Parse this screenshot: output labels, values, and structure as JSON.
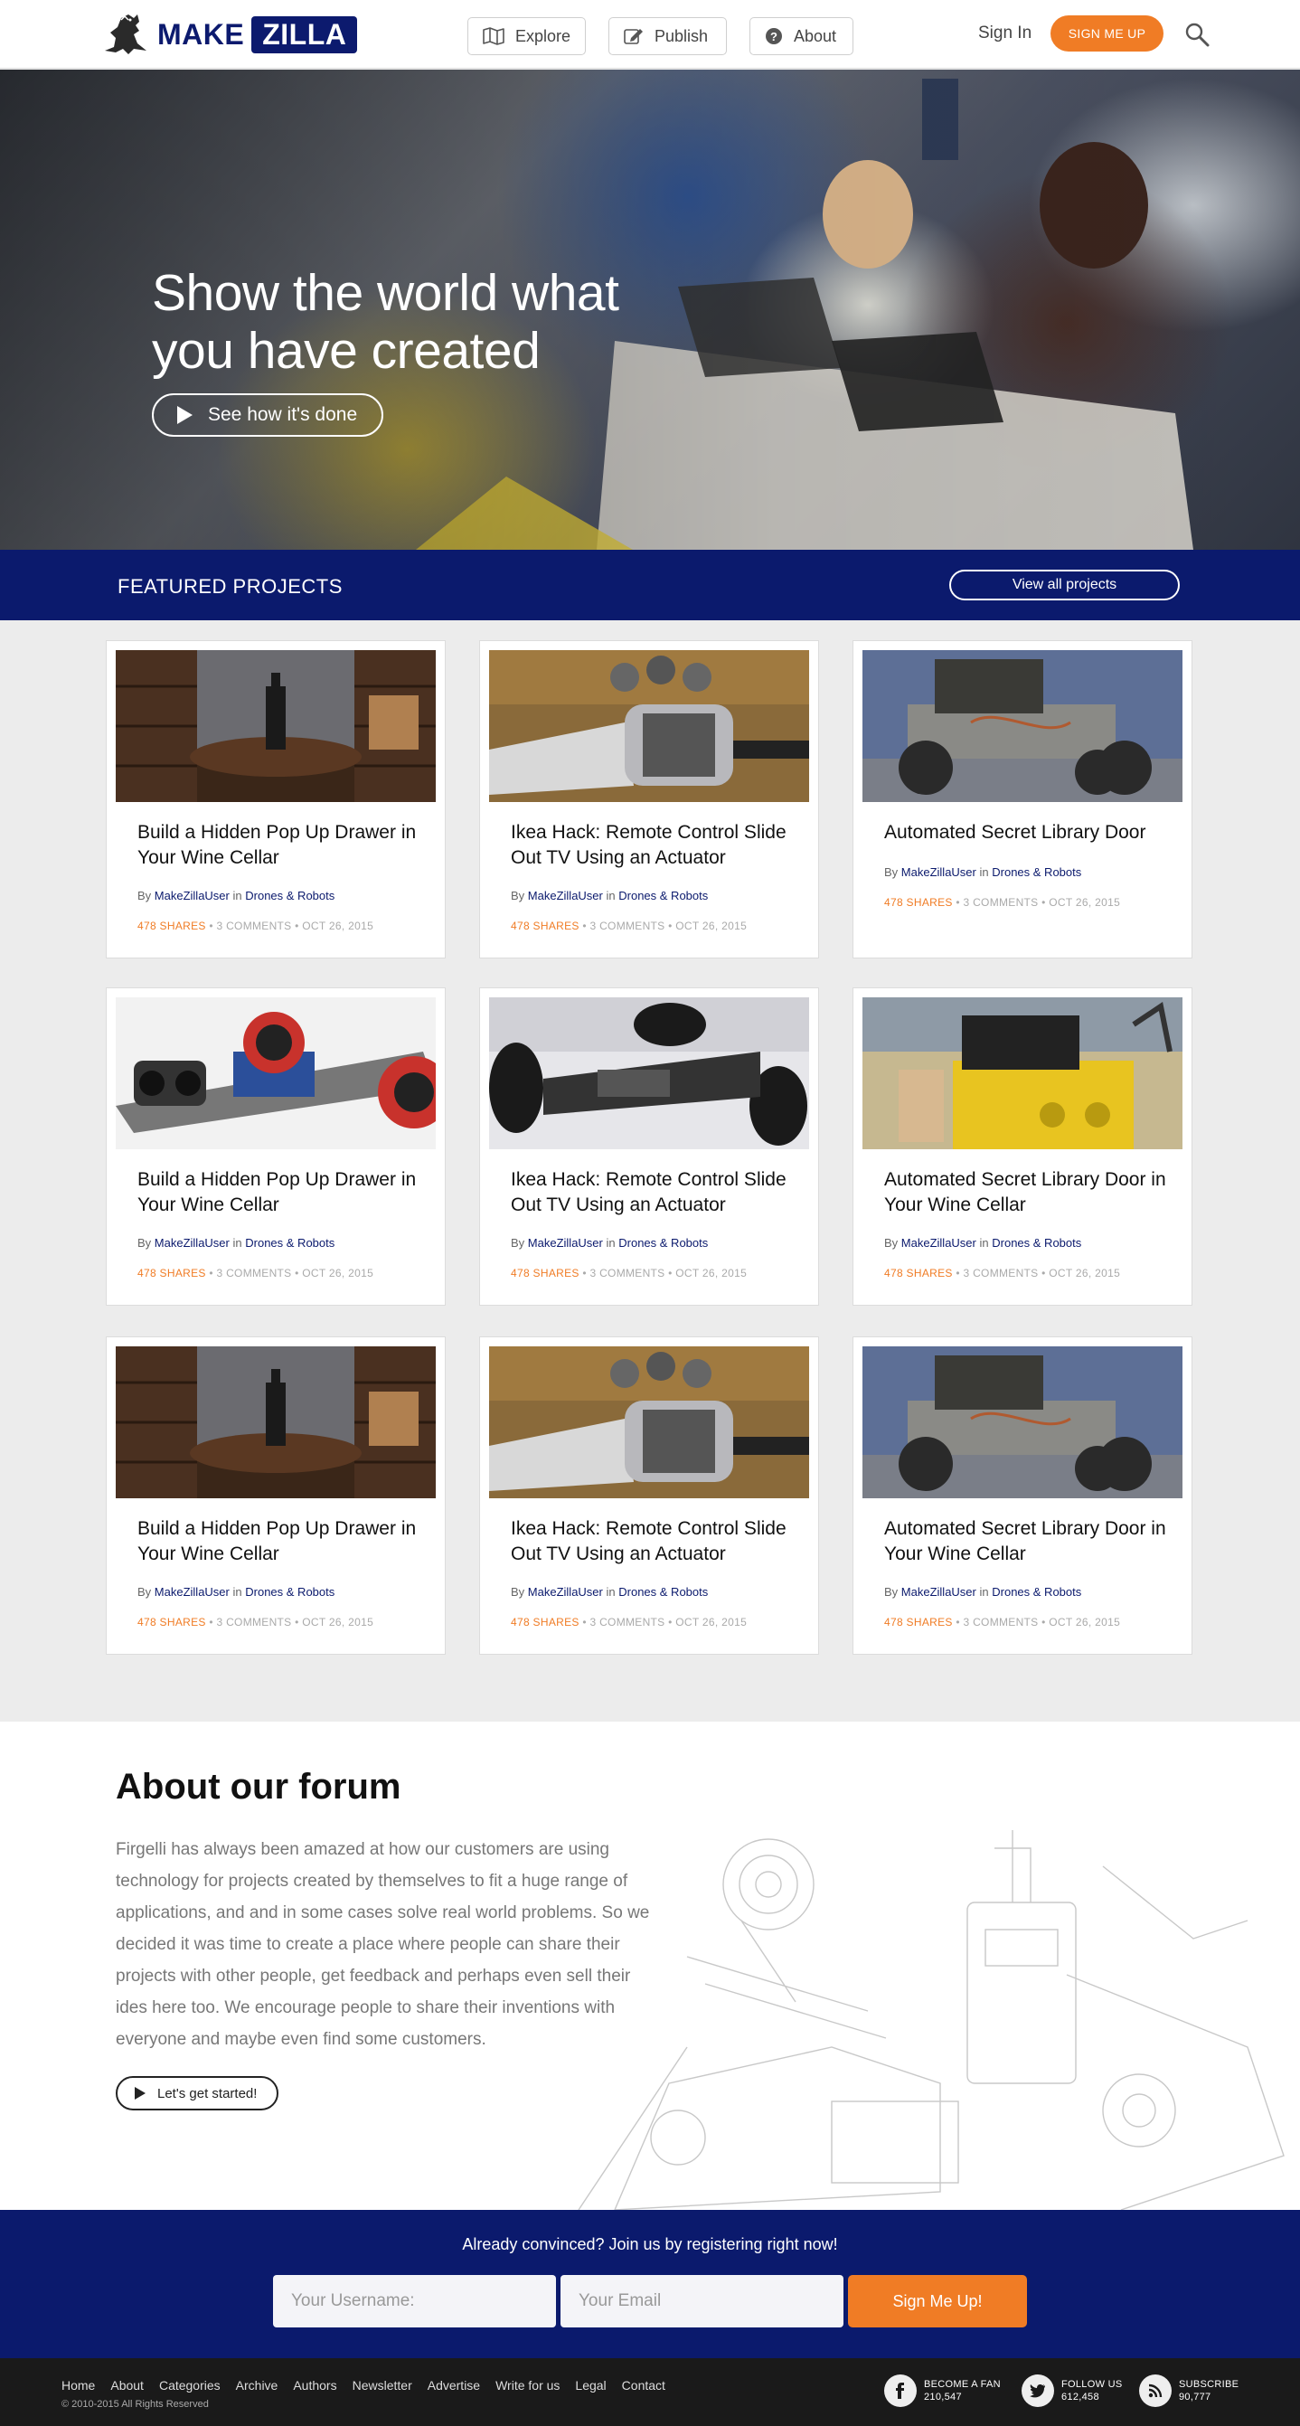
{
  "header": {
    "logo_make": "MAKE",
    "logo_zilla": "ZILLA",
    "nav": [
      {
        "label": "Explore",
        "icon": "map-icon"
      },
      {
        "label": "Publish",
        "icon": "edit-icon"
      },
      {
        "label": "About",
        "icon": "help-icon"
      }
    ],
    "signin": "Sign In",
    "signup": "SIGN ME UP"
  },
  "hero": {
    "title": "Show the world what you have created",
    "cta": "See how it's done"
  },
  "featured": {
    "title": "FEATURED PROJECTS",
    "view_all": "View all projects"
  },
  "cards": [
    {
      "title": "Build a Hidden Pop Up Drawer in Your Wine Cellar",
      "by": "By",
      "author": "MakeZillaUser",
      "in": "in",
      "category": "Drones & Robots",
      "shares": "478 SHARES",
      "comments": "3 COMMENTS",
      "date": "OCT 26, 2015",
      "image": "wine-cellar"
    },
    {
      "title": "Ikea Hack: Remote Control Slide Out TV Using an Actuator",
      "by": "By",
      "author": "MakeZillaUser",
      "in": "in",
      "category": "Drones & Robots",
      "shares": "478 SHARES",
      "comments": "3 COMMENTS",
      "date": "OCT 26, 2015",
      "image": "actuator"
    },
    {
      "title": "Automated Secret Library Door",
      "by": "By",
      "author": "MakeZillaUser",
      "in": "in",
      "category": "Drones & Robots",
      "shares": "478 SHARES",
      "comments": "3 COMMENTS",
      "date": "OCT 26, 2015",
      "image": "robot-base"
    },
    {
      "title": "Build a Hidden Pop Up Drawer in Your Wine Cellar",
      "by": "By",
      "author": "MakeZillaUser",
      "in": "in",
      "category": "Drones & Robots",
      "shares": "478 SHARES",
      "comments": "3 COMMENTS",
      "date": "OCT 26, 2015",
      "image": "robot-car"
    },
    {
      "title": "Ikea Hack: Remote Control Slide Out TV Using an Actuator",
      "by": "By",
      "author": "MakeZillaUser",
      "in": "in",
      "category": "Drones & Robots",
      "shares": "478 SHARES",
      "comments": "3 COMMENTS",
      "date": "OCT 26, 2015",
      "image": "race-car"
    },
    {
      "title": "Automated Secret Library Door in Your Wine Cellar",
      "by": "By",
      "author": "MakeZillaUser",
      "in": "in",
      "category": "Drones & Robots",
      "shares": "478 SHARES",
      "comments": "3 COMMENTS",
      "date": "OCT 26, 2015",
      "image": "yellow-robot"
    },
    {
      "title": "Build a Hidden Pop Up Drawer in Your Wine Cellar",
      "by": "By",
      "author": "MakeZillaUser",
      "in": "in",
      "category": "Drones & Robots",
      "shares": "478 SHARES",
      "comments": "3 COMMENTS",
      "date": "OCT 26, 2015",
      "image": "wine-cellar"
    },
    {
      "title": "Ikea Hack: Remote Control Slide Out TV Using an Actuator",
      "by": "By",
      "author": "MakeZillaUser",
      "in": "in",
      "category": "Drones & Robots",
      "shares": "478 SHARES",
      "comments": "3 COMMENTS",
      "date": "OCT 26, 2015",
      "image": "actuator"
    },
    {
      "title": "Automated Secret Library Door in Your Wine Cellar",
      "by": "By",
      "author": "MakeZillaUser",
      "in": "in",
      "category": "Drones & Robots",
      "shares": "478 SHARES",
      "comments": "3 COMMENTS",
      "date": "OCT 26, 2015",
      "image": "robot-base"
    }
  ],
  "about": {
    "title": "About our forum",
    "text": "Firgelli has always been amazed at how our customers are using technology for projects created by themselves to fit a huge range of applications, and and in some cases solve real world problems. So we decided it was time to create a place where people can share their projects with other people, get feedback and perhaps even sell their ides here too. We encourage people to share their inventions with everyone and maybe even find some customers.",
    "cta": "Let's get started!"
  },
  "signup": {
    "heading": "Already convinced? Join us by registering right now!",
    "username_placeholder": "Your Username:",
    "email_placeholder": "Your Email",
    "submit": "Sign Me Up!"
  },
  "footer": {
    "links": [
      "Home",
      "About",
      "Categories",
      "Archive",
      "Authors",
      "Newsletter",
      "Advertise",
      "Write for us",
      "Legal",
      "Contact"
    ],
    "copyright": "© 2010-2015 All Rights Reserved",
    "social": [
      {
        "label": "BECOME A FAN",
        "count": "210,547",
        "icon": "facebook-icon"
      },
      {
        "label": "FOLLOW US",
        "count": "612,458",
        "icon": "twitter-icon"
      },
      {
        "label": "SUBSCRIBE",
        "count": "90,777",
        "icon": "rss-icon"
      }
    ]
  },
  "colors": {
    "brand_navy": "#0b1a6d",
    "accent_orange": "#f07c25"
  }
}
